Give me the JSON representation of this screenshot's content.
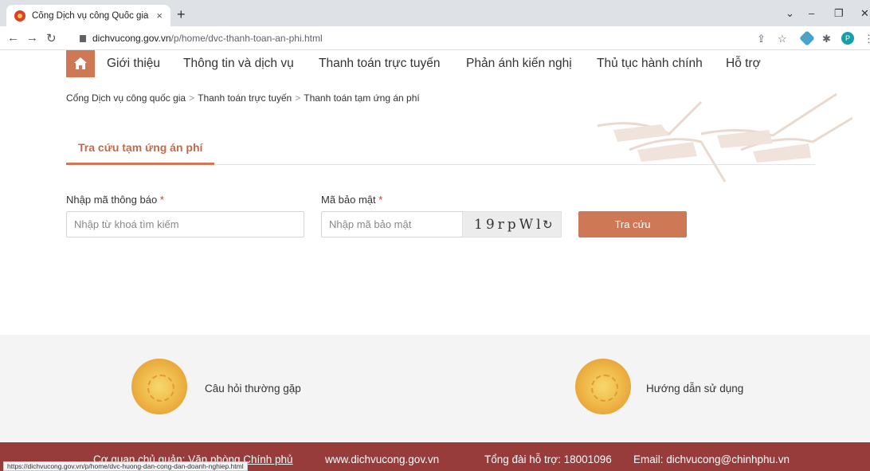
{
  "browser": {
    "tab_title": "Cổng Dịch vụ công Quốc gia",
    "tab_close": "×",
    "new_tab": "+",
    "url_host": "dichvucong.gov.vn",
    "url_path": "/p/home/dvc-thanh-toan-an-phi.html",
    "profile_initial": "P",
    "status_url": "https://dichvucong.gov.vn/p/home/dvc-huong-dan-cong-dan-doanh-nghiep.html"
  },
  "nav": {
    "items": [
      "Giới thiệu",
      "Thông tin và dịch vụ",
      "Thanh toán trực tuyến",
      "Phản ánh kiến nghị",
      "Thủ tục hành chính",
      "Hỗ trợ"
    ]
  },
  "breadcrumb": {
    "items": [
      "Cổng Dịch vụ công quốc gia",
      "Thanh toán trực tuyến",
      "Thanh toán tạm ứng án phí"
    ],
    "separator": ">"
  },
  "tabs": {
    "active": "Tra cứu tạm ứng án phí"
  },
  "form": {
    "notice_label": "Nhập mã thông báo",
    "notice_placeholder": "Nhập từ khoá tìm kiếm",
    "security_label": "Mã bảo mật",
    "security_placeholder": "Nhập mã bảo mật",
    "required_mark": "*",
    "captcha_code": "19rpWl",
    "search_button": "Tra cứu"
  },
  "info": {
    "faq": "Câu hỏi thường gặp",
    "guide": "Hướng dẫn sử dụng"
  },
  "footer": {
    "agency": "Cơ quan chủ quản: Văn phòng Chính phủ",
    "website": "www.dichvucong.gov.vn",
    "hotline": "Tổng đài hỗ trợ: 18001096",
    "email": "Email: dichvucong@chinhphu.vn"
  },
  "colors": {
    "accent": "#cf7856",
    "footer": "#983b3b",
    "required": "#d9332b"
  }
}
